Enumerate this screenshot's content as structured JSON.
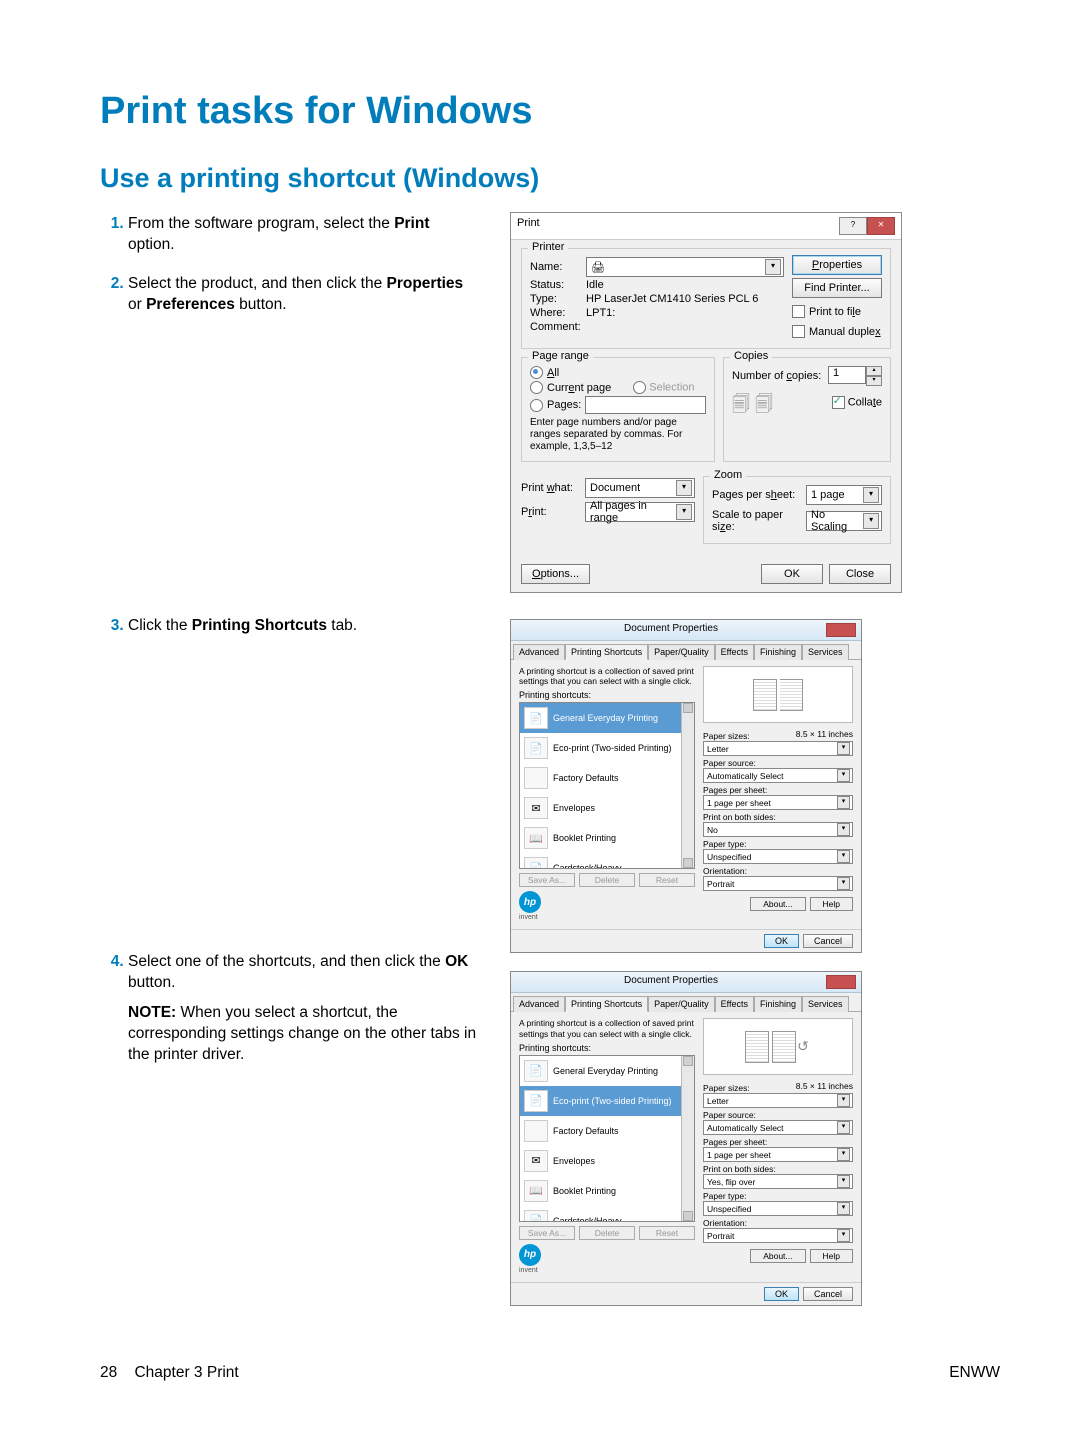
{
  "page": {
    "title": "Print tasks for Windows",
    "subtitle": "Use a printing shortcut (Windows)",
    "page_number": "28",
    "chapter": "Chapter 3   Print",
    "brand": "ENWW"
  },
  "steps": {
    "s1a": "From the software program, select the ",
    "s1b": "Print",
    "s1c": " option.",
    "s2a": "Select the product, and then click the ",
    "s2b": "Properties",
    "s2c": " or ",
    "s2d": "Preferences",
    "s2e": " button.",
    "s3a": "Click the ",
    "s3b": "Printing Shortcuts",
    "s3c": " tab.",
    "s4a": "Select one of the shortcuts, and then click the ",
    "s4b": "OK",
    "s4c": " button.",
    "s4note_label": "NOTE:",
    "s4note": "   When you select a shortcut, the corresponding settings change on the other tabs in the printer driver."
  },
  "print_dialog": {
    "title": "Print",
    "printer_label": "Printer",
    "name_label": "Name:",
    "name_value": "",
    "status_label": "Status:",
    "status_value": "Idle",
    "type_label": "Type:",
    "type_value": "HP LaserJet CM1410 Series PCL 6",
    "where_label": "Where:",
    "where_value": "LPT1:",
    "comment_label": "Comment:",
    "properties_btn": "Properties",
    "find_btn": "Find Printer...",
    "print_file": "Print to file",
    "manual_duplex": "Manual duplex",
    "page_range_label": "Page range",
    "all": "All",
    "current": "Current page",
    "selection": "Selection",
    "pages": "Pages:",
    "pages_hint": "Enter page numbers and/or page ranges separated by commas.  For example, 1,3,5–12",
    "copies_label": "Copies",
    "num_copies_label": "Number of copies:",
    "num_copies_value": "1",
    "collate": "Collate",
    "print_what_label": "Print what:",
    "print_what_value": "Document",
    "print_label": "Print:",
    "print_value": "All pages in range",
    "zoom_label": "Zoom",
    "pps_label": "Pages per sheet:",
    "pps_value": "1 page",
    "scale_label": "Scale to paper size:",
    "scale_value": "No Scaling",
    "options_btn": "Options...",
    "ok_btn": "OK",
    "close_btn": "Close"
  },
  "props_dialog": {
    "title": "Document Properties",
    "tabs": [
      "Advanced",
      "Printing Shortcuts",
      "Paper/Quality",
      "Effects",
      "Finishing",
      "Services"
    ],
    "desc": "A printing shortcut is a collection of saved print settings that you can select with a single click.",
    "shortcuts_label": "Printing shortcuts:",
    "items": [
      {
        "label": "General Everyday Printing",
        "icon": "📄"
      },
      {
        "label": "Eco-print (Two-sided Printing)",
        "icon": "📄"
      },
      {
        "label": "Factory Defaults",
        "icon": ""
      },
      {
        "label": "Envelopes",
        "icon": "✉"
      },
      {
        "label": "Booklet Printing",
        "icon": "📖"
      },
      {
        "label": "Cardstock/Heavy",
        "icon": "📄"
      }
    ],
    "saveas": "Save As...",
    "delete": "Delete",
    "reset": "Reset",
    "paper_sizes_label": "Paper sizes:",
    "paper_sizes_dim": "8.5 × 11 inches",
    "paper_sizes_value": "Letter",
    "paper_source_label": "Paper source:",
    "paper_source_value": "Automatically Select",
    "pps_label": "Pages per sheet:",
    "pps_value": "1 page per sheet",
    "both_sides_label": "Print on both sides:",
    "both_sides_value_3": "No",
    "both_sides_value_4": "Yes, flip over",
    "paper_type_label": "Paper type:",
    "paper_type_value": "Unspecified",
    "orientation_label": "Orientation:",
    "orientation_value": "Portrait",
    "about": "About...",
    "help": "Help",
    "ok": "OK",
    "cancel": "Cancel",
    "invent": "invent"
  }
}
